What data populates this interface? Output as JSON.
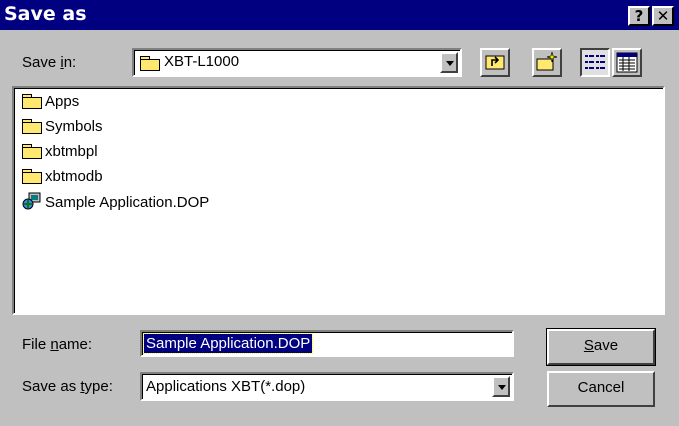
{
  "window": {
    "title": "Save as",
    "help_glyph": "?",
    "close_glyph": "✕"
  },
  "location": {
    "label_prefix": "Save ",
    "label_mnemonic": "i",
    "label_suffix": "n:",
    "value": "XBT-L1000"
  },
  "toolbar": {
    "icons": [
      "up-one-level-icon",
      "create-new-folder-icon",
      "list-view-icon",
      "details-view-icon"
    ],
    "active_view": "list"
  },
  "files": [
    {
      "name": "Apps",
      "kind": "folder"
    },
    {
      "name": "Symbols",
      "kind": "folder"
    },
    {
      "name": "xbtmbpl",
      "kind": "folder"
    },
    {
      "name": "xbtmodb",
      "kind": "folder"
    },
    {
      "name": "Sample Application.DOP",
      "kind": "application"
    }
  ],
  "filename": {
    "label_prefix": "File ",
    "label_mnemonic": "n",
    "label_suffix": "ame:",
    "value": "Sample Application.DOP"
  },
  "filetype": {
    "label_prefix": "Save as ",
    "label_mnemonic": "t",
    "label_suffix": "ype:",
    "value": "Applications XBT(*.dop)"
  },
  "buttons": {
    "save_mnemonic": "S",
    "save_rest": "ave",
    "cancel": "Cancel"
  },
  "colors": {
    "titlebar": "#000080",
    "selection": "#000080",
    "face": "#c0c0c0"
  }
}
